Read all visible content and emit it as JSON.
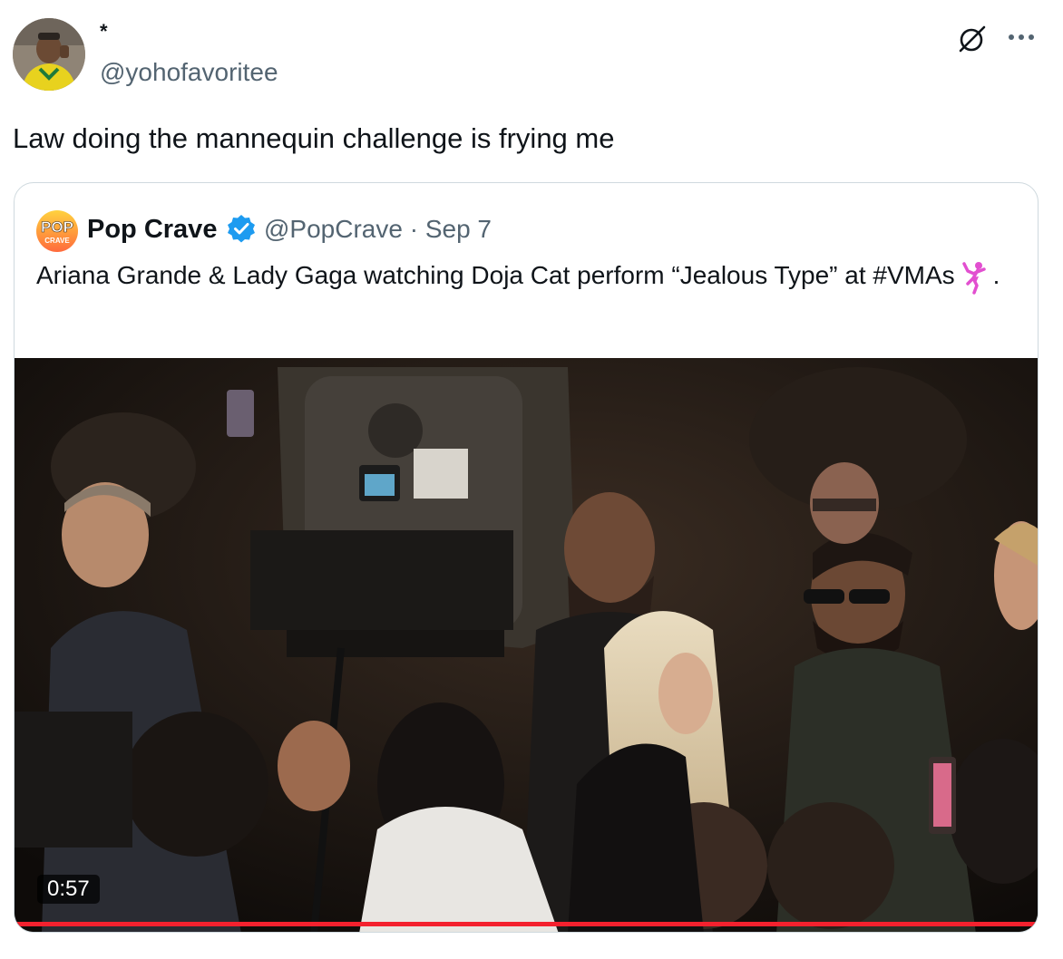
{
  "tweet": {
    "display_name": "*",
    "handle": "@yohofavoritee",
    "text": "Law doing the mannequin challenge is frying me",
    "avatar_icon": "user-avatar",
    "actions": [
      "grok-icon",
      "more-icon"
    ]
  },
  "quote": {
    "name": "Pop Crave",
    "handle_date": "@PopCrave · Sep 7",
    "verified": true,
    "verified_color": "#1d9bf0",
    "text_main": "Ariana Grande & Lady Gaga watching Doja Cat perform “Jealous Type” at #VMAs",
    "text_end": ".",
    "emoji": "woman-dancing-emoji",
    "avatar_logo_top": "POP",
    "avatar_logo_bottom": "CRAVE",
    "video": {
      "duration": "0:57",
      "progress_color": "#f4212e"
    }
  }
}
